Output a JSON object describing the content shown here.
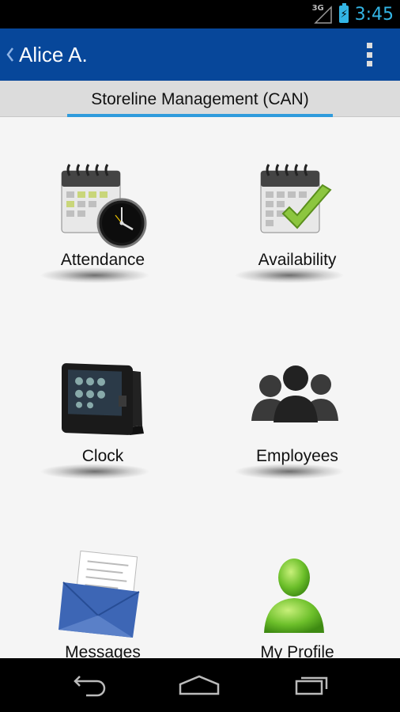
{
  "status_bar": {
    "network": "3G",
    "time": "3:45",
    "icons": [
      "signal-icon",
      "battery-charging-icon"
    ],
    "accent_color": "#33b5e5"
  },
  "action_bar": {
    "title": "Alice A.",
    "background_color": "#07479a",
    "icons": [
      "back-chevron-icon",
      "overflow-menu-icon"
    ]
  },
  "tab": {
    "label": "Storeline Management (CAN)",
    "indicator_color": "#2f9bdc"
  },
  "menu_items": [
    {
      "label": "Attendance",
      "icon": "calendar-clock-icon"
    },
    {
      "label": "Availability",
      "icon": "calendar-check-icon"
    },
    {
      "label": "Clock",
      "icon": "time-clock-terminal-icon"
    },
    {
      "label": "Employees",
      "icon": "employees-group-icon"
    },
    {
      "label": "Messages",
      "icon": "envelope-messages-icon"
    },
    {
      "label": "My Profile",
      "icon": "user-profile-icon"
    }
  ],
  "nav_bar": {
    "icons": [
      "back-nav-icon",
      "home-nav-icon",
      "recent-apps-icon"
    ]
  }
}
